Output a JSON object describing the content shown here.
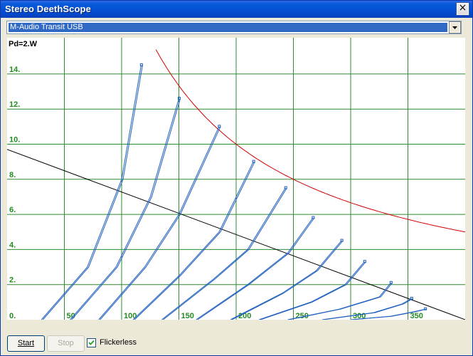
{
  "window": {
    "title": "Stereo DeethScope",
    "close_glyph": "×"
  },
  "device_select": {
    "value": "M-Audio Transit USB"
  },
  "scope": {
    "power_label": "Pd=2.W",
    "y_ticks": [
      "0.",
      "2.",
      "4.",
      "6.",
      "8.",
      "10.",
      "12.",
      "14."
    ],
    "x_ticks": [
      "50",
      "100",
      "150",
      "200",
      "250",
      "300",
      "350"
    ],
    "colors": {
      "grid": "#2e8b2e",
      "axis_text": "#228b22",
      "power": "#d00000",
      "load": "#000000",
      "trace": "#1f5fbf"
    }
  },
  "chart_data": {
    "type": "line",
    "xlim": [
      0,
      400
    ],
    "ylim": [
      0,
      16
    ],
    "x_ticks": [
      50,
      100,
      150,
      200,
      250,
      300,
      350
    ],
    "y_ticks": [
      0,
      2,
      4,
      6,
      8,
      10,
      12,
      14
    ],
    "grid": true,
    "power_curve": {
      "label": "Pd=2.W",
      "watts": 2,
      "x_start": 130,
      "x_end": 400
    },
    "load_line": [
      [
        0,
        9.7
      ],
      [
        400,
        0
      ]
    ],
    "series": [
      {
        "points": [
          [
            30,
            0
          ],
          [
            70,
            3
          ],
          [
            100,
            8
          ],
          [
            117,
            14.5
          ]
        ]
      },
      {
        "points": [
          [
            55,
            0
          ],
          [
            95,
            3
          ],
          [
            125,
            7
          ],
          [
            150,
            12.6
          ]
        ]
      },
      {
        "points": [
          [
            80,
            0
          ],
          [
            120,
            3
          ],
          [
            150,
            6
          ],
          [
            185,
            11.0
          ]
        ]
      },
      {
        "points": [
          [
            110,
            0
          ],
          [
            150,
            2.5
          ],
          [
            185,
            5
          ],
          [
            215,
            9.0
          ]
        ]
      },
      {
        "points": [
          [
            135,
            0
          ],
          [
            180,
            2.3
          ],
          [
            210,
            4
          ],
          [
            243,
            7.5
          ]
        ]
      },
      {
        "points": [
          [
            165,
            0
          ],
          [
            210,
            2
          ],
          [
            245,
            3.8
          ],
          [
            267,
            5.8
          ]
        ]
      },
      {
        "points": [
          [
            195,
            0
          ],
          [
            240,
            1.5
          ],
          [
            270,
            2.8
          ],
          [
            292,
            4.5
          ]
        ]
      },
      {
        "points": [
          [
            220,
            0
          ],
          [
            265,
            1
          ],
          [
            295,
            2
          ],
          [
            312,
            3.3
          ]
        ]
      },
      {
        "points": [
          [
            245,
            0
          ],
          [
            290,
            0.6
          ],
          [
            325,
            1.3
          ],
          [
            335,
            2.1
          ]
        ]
      },
      {
        "points": [
          [
            275,
            0
          ],
          [
            320,
            0.4
          ],
          [
            345,
            0.9
          ],
          [
            353,
            1.2
          ]
        ]
      },
      {
        "points": [
          [
            300,
            0
          ],
          [
            335,
            0.2
          ],
          [
            355,
            0.45
          ],
          [
            365,
            0.6
          ]
        ]
      }
    ]
  },
  "controls": {
    "start": "Start",
    "stop": "Stop",
    "flickerless": "Flickerless",
    "flickerless_checked": true
  }
}
